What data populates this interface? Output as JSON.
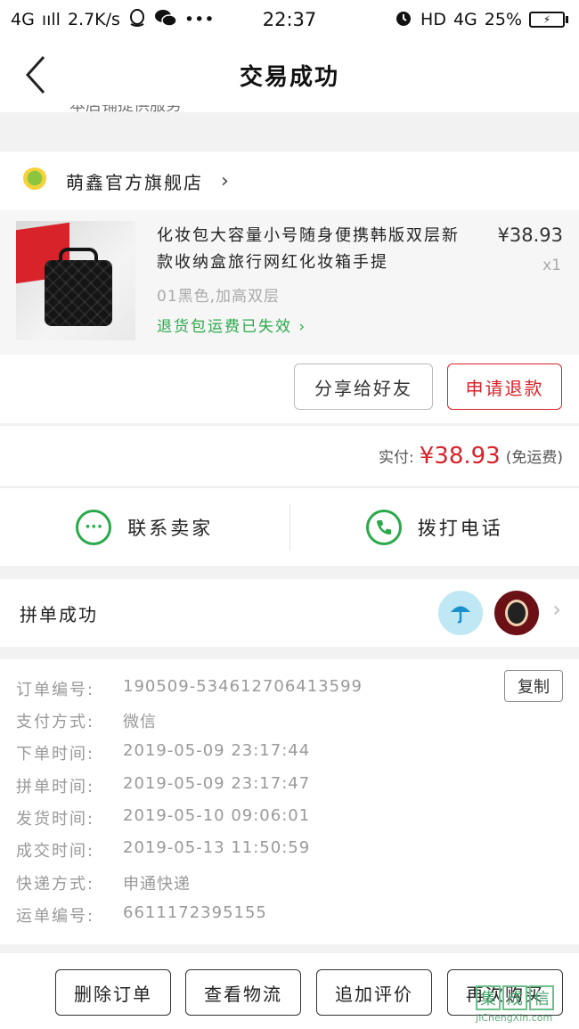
{
  "status_bar": {
    "network": "4G",
    "signal": "ııll",
    "speed": "2.7K/s",
    "time": "22:37",
    "hd": "HD",
    "network_right": "4G",
    "battery": "25%"
  },
  "nav": {
    "title": "交易成功",
    "peek_text": "本店铺提供服务"
  },
  "shop": {
    "name": "萌鑫官方旗舰店"
  },
  "product": {
    "title": "化妆包大容量小号随身便携韩版双层新款收纳盒旅行网红化妆箱手提",
    "price": "¥38.93",
    "qty": "x1",
    "sku": "01黑色,加高双层",
    "notice": "退货包运费已失效"
  },
  "actions": {
    "share": "分享给好友",
    "refund": "申请退款"
  },
  "payment": {
    "label": "实付:",
    "amount": "¥38.93",
    "note": "(免运费)"
  },
  "contact": {
    "seller": "联系卖家",
    "call": "拨打电话"
  },
  "group": {
    "label": "拼单成功"
  },
  "order": {
    "copy": "复制",
    "rows": [
      {
        "label": "订单编号:",
        "value": "190509-534612706413599"
      },
      {
        "label": "支付方式:",
        "value": "微信"
      },
      {
        "label": "下单时间:",
        "value": "2019-05-09 23:17:44"
      },
      {
        "label": "拼单时间:",
        "value": "2019-05-09 23:17:47"
      },
      {
        "label": "发货时间:",
        "value": "2019-05-10 09:06:01"
      },
      {
        "label": "成交时间:",
        "value": "2019-05-13 11:50:59"
      },
      {
        "label": "快递方式:",
        "value": "申通快递"
      },
      {
        "label": "运单编号:",
        "value": "6611172395155"
      }
    ]
  },
  "bottom": {
    "delete": "删除订单",
    "logistics": "查看物流",
    "review": "追加评价",
    "rebuy": "再次购买"
  },
  "watermark": {
    "text": "JiChengXin.com",
    "glyph_1": "集",
    "glyph_2": "成",
    "glyph_3": "信"
  },
  "colors": {
    "accent_red": "#d8232a",
    "accent_green": "#2aa94a"
  }
}
